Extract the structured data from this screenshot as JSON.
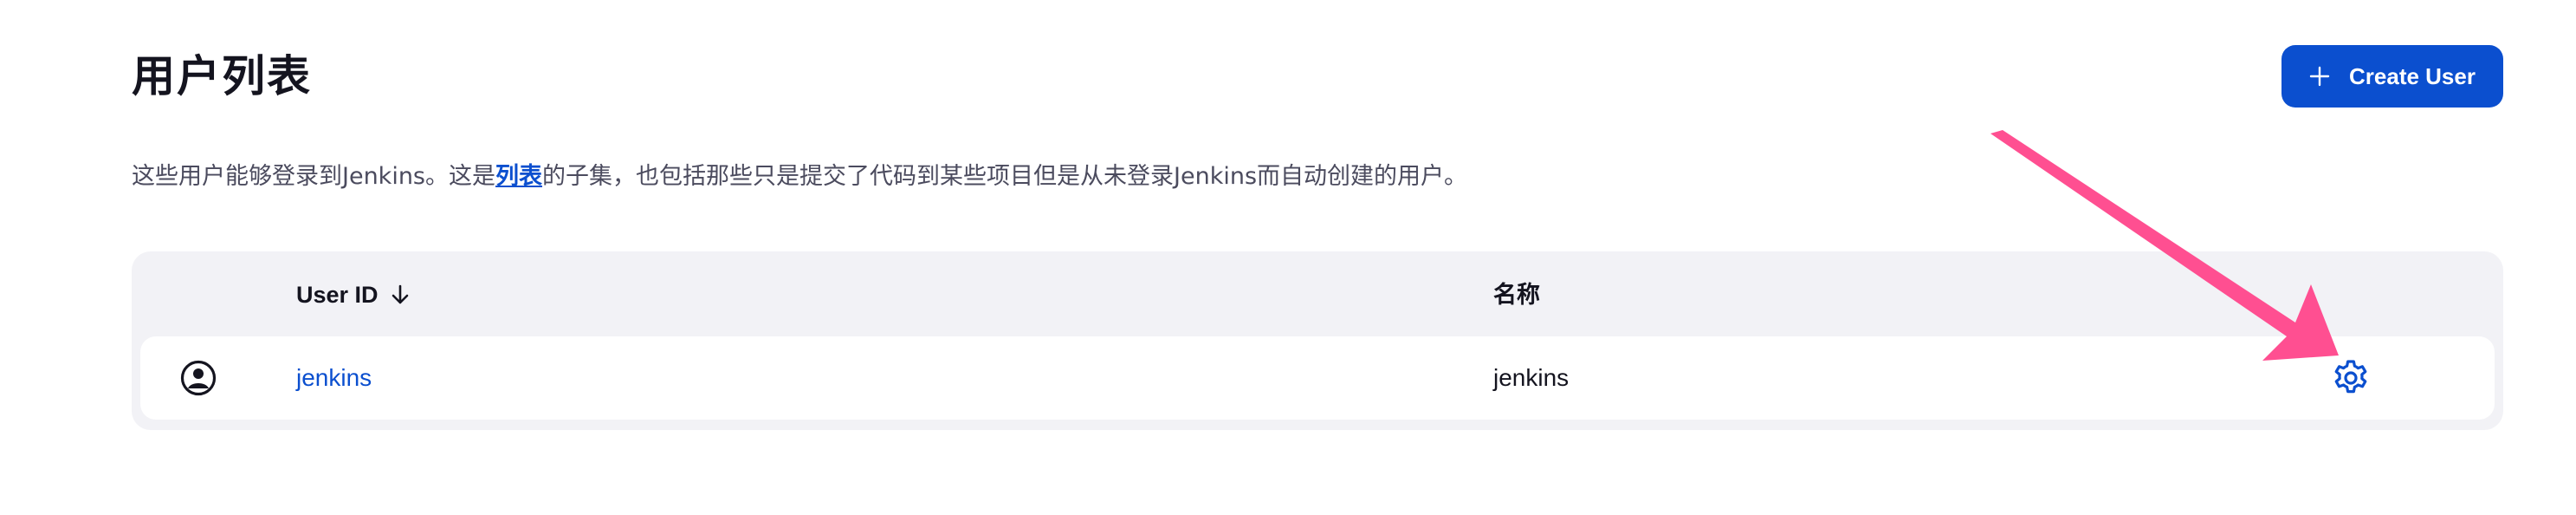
{
  "header": {
    "title": "用户列表",
    "create_button_label": "Create User"
  },
  "description": {
    "before_link": "这些用户能够登录到Jenkins。这是",
    "link_text": "列表",
    "after_link": "的子集，也包括那些只是提交了代码到某些项目但是从未登录Jenkins而自动创建的用户。"
  },
  "table": {
    "columns": {
      "user_id": "User ID",
      "name": "名称"
    },
    "sort": "descending",
    "rows": [
      {
        "user_id": "jenkins",
        "name": "jenkins"
      }
    ]
  },
  "colors": {
    "accent": "#0b4fcf",
    "annotation": "#ff4f91",
    "table_bg": "#f2f2f6"
  },
  "icons": {
    "create": "plus-icon",
    "sort": "arrow-down-icon",
    "avatar": "user-circle-icon",
    "settings": "gear-icon"
  }
}
